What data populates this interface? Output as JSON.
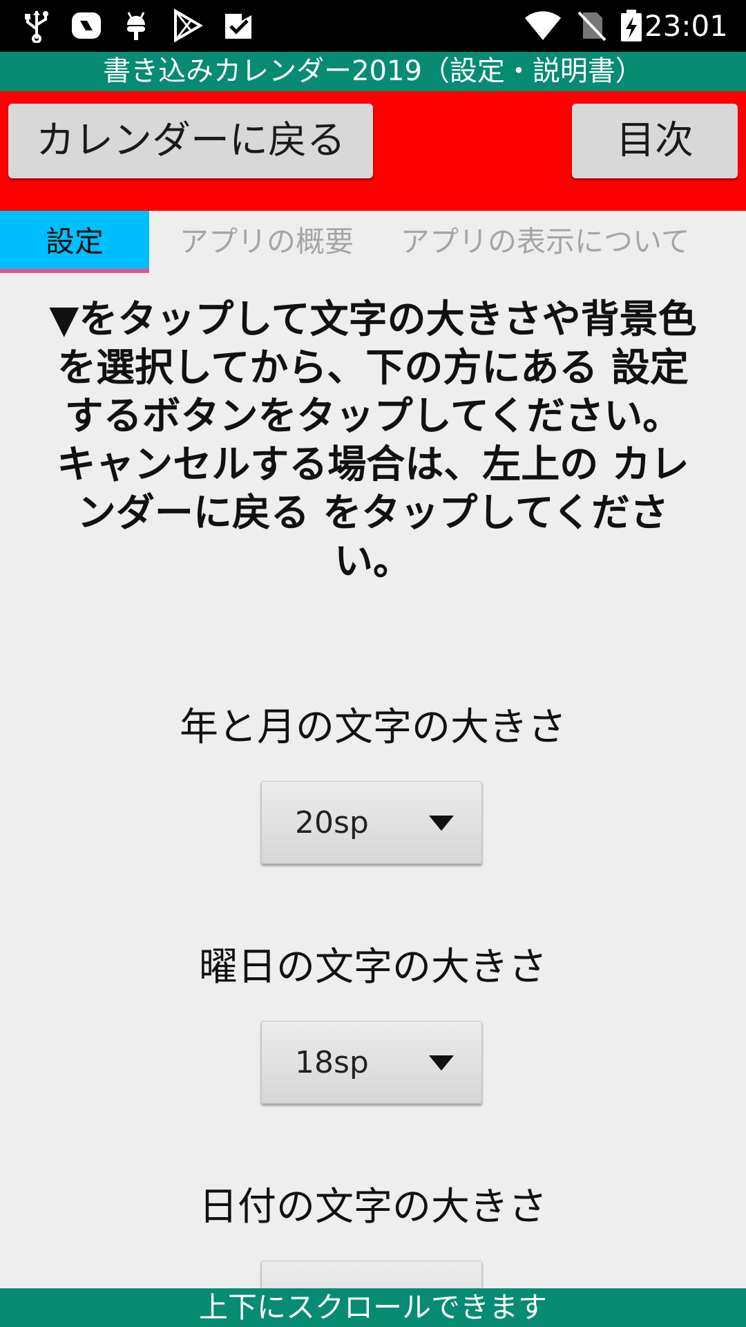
{
  "status_bar": {
    "icons": [
      "usb-icon",
      "chat-bubble-icon",
      "android-debug-icon",
      "play-store-icon",
      "task-check-icon",
      "wifi-icon",
      "no-sim-icon",
      "battery-charging-icon"
    ],
    "time": "23:01"
  },
  "title_bar": {
    "title": "書き込みカレンダー2019（設定・説明書）"
  },
  "toolbar": {
    "back_label": "カレンダーに戻る",
    "toc_label": "目次",
    "background": "#ff0000"
  },
  "tabs": [
    {
      "label": "設定",
      "active": true
    },
    {
      "label": "アプリの概要",
      "active": false
    },
    {
      "label": "アプリの表示について",
      "active": false
    }
  ],
  "instruction": {
    "lines": [
      "▼をタップして文字の大きさや背景色",
      "を選択してから、下の方にある 設定",
      "するボタンをタップしてください。",
      "キャンセルする場合は、左上の カレ",
      "ンダーに戻る をタップしてくださ",
      "い。"
    ]
  },
  "settings": [
    {
      "label": "年と月の文字の大きさ",
      "value": "20sp"
    },
    {
      "label": "曜日の文字の大きさ",
      "value": "18sp"
    },
    {
      "label": "日付の文字の大きさ",
      "value": ""
    }
  ],
  "bottom_bar": {
    "text": "上下にスクロールできます"
  },
  "colors": {
    "accent_green": "#078b72",
    "active_tab": "#00bfff",
    "tab_indicator": "#e8508a"
  }
}
